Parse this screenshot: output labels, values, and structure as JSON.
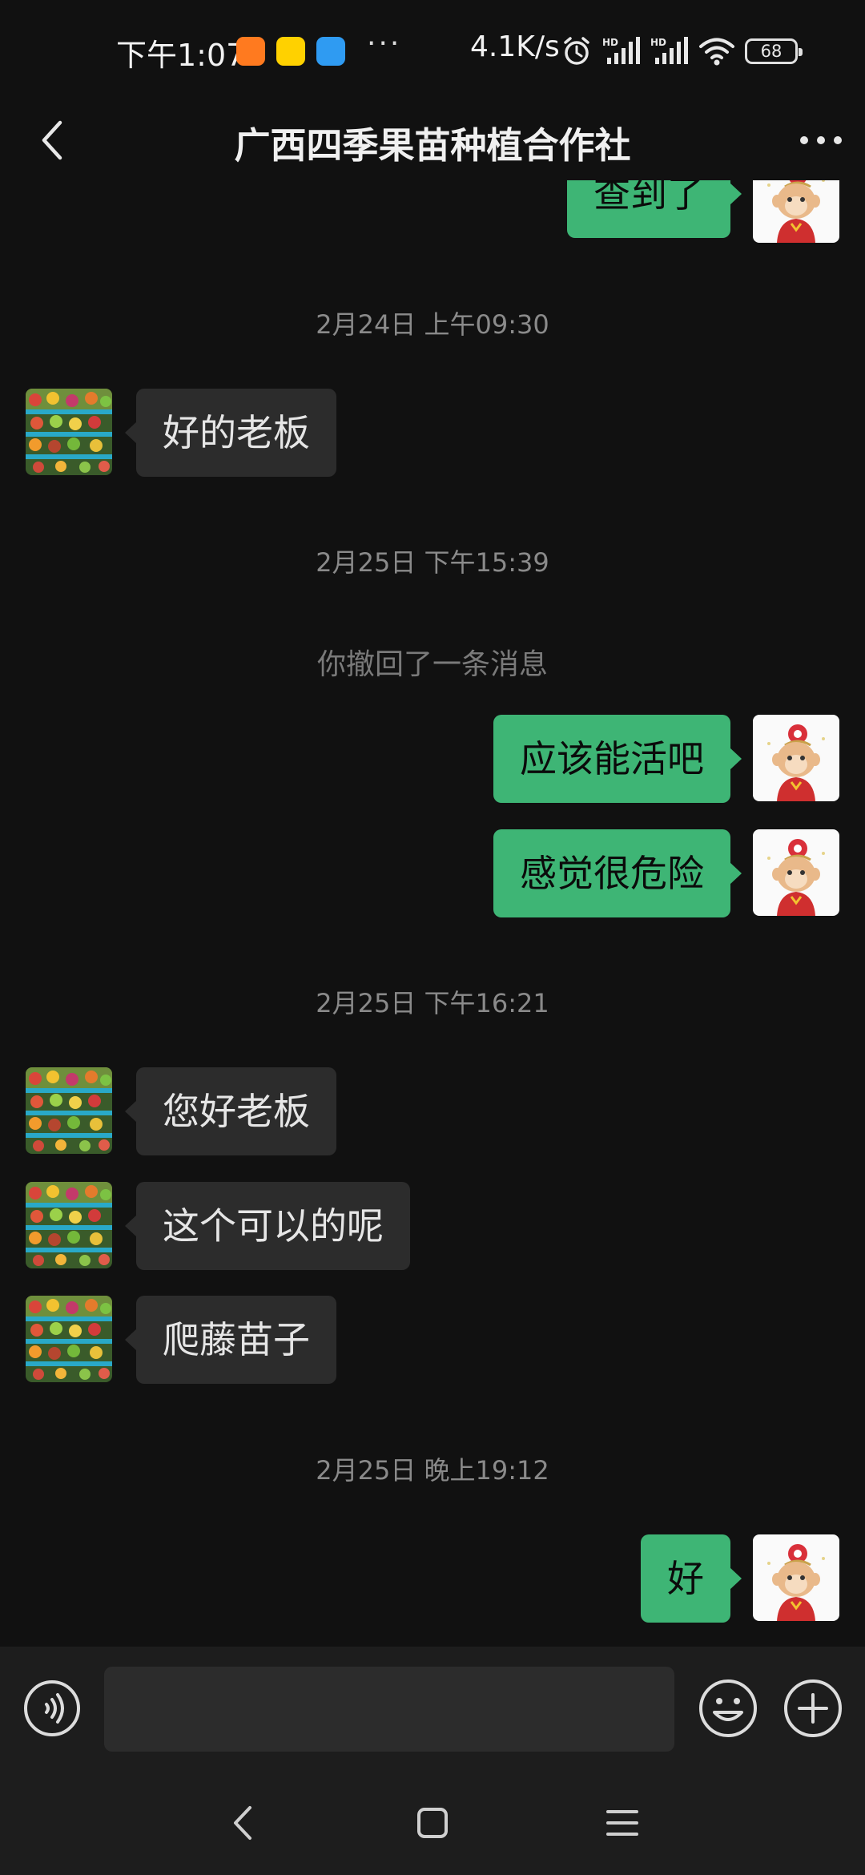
{
  "status_bar": {
    "time": "下午1:07",
    "net_speed": "4.1K/s",
    "battery": "68",
    "signal_label": "HD",
    "apps": [
      {
        "icon": "app-orange-icon",
        "color": "#ff7a1f"
      },
      {
        "icon": "meituan-icon",
        "color": "#ffd100"
      },
      {
        "icon": "tplink-icon",
        "color": "#2f9bf2"
      }
    ]
  },
  "header": {
    "title": "广西四季果苗种植合作社"
  },
  "colors": {
    "background": "#111111",
    "incoming_bubble": "#2c2c2c",
    "outgoing_bubble": "#3eb575",
    "timestamp": "#8a8a8a"
  },
  "chat": {
    "top_partial_message": "查到了",
    "timestamps": {
      "t1": "2月24日 上午09:30",
      "t2": "2月25日 下午15:39",
      "t3": "2月25日 下午16:21",
      "t4": "2月25日 晚上19:12"
    },
    "system_notice": "你撤回了一条消息",
    "messages": [
      {
        "from": "contact",
        "text": "好的老板"
      },
      {
        "from": "me",
        "text": "应该能活吧"
      },
      {
        "from": "me",
        "text": "感觉很危险"
      },
      {
        "from": "contact",
        "text": "您好老板"
      },
      {
        "from": "contact",
        "text": "这个可以的呢"
      },
      {
        "from": "contact",
        "text": "爬藤苗子"
      },
      {
        "from": "me",
        "text": "好"
      }
    ]
  },
  "input": {
    "value": "",
    "placeholder": ""
  }
}
